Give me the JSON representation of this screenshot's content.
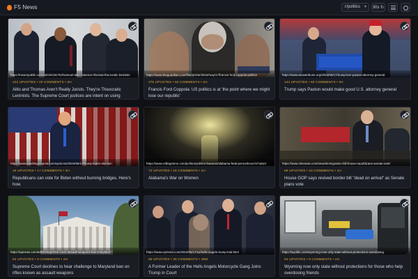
{
  "app": {
    "title": "F5 News"
  },
  "toolbar": {
    "subreddit": "r/politics",
    "refresh_label": "30s",
    "icons": [
      "chevron-down-icon",
      "refresh-icon",
      "grid-icon",
      "gear-icon"
    ]
  },
  "colors": {
    "accent": "#e2a93b",
    "background": "#0f1115",
    "card": "#1a1d24",
    "logo": "#f47b20"
  },
  "cards": [
    {
      "url": "https://newrepublic.com/article/181752/samuel-alito-clarence-thomas-theocratic-leninists",
      "meta": "423 UPVOTES • 20 COMMENTS • 2H",
      "title": "Alito and Thomas Aren't Really Jurists. They're Theocratic Leninists. The Supreme Court justices are intent on using maxim..."
    },
    {
      "url": "https://www.theguardian.com/film/article/2024/may/17/francis-ford-coppola-politics",
      "meta": "275 UPVOTES • 50 COMMENTS • 2H",
      "title": "Francis Ford Coppola: US politics is at 'the point where we might lose our republic'"
    },
    {
      "url": "https://www.texastribune.org/2024/05/17/trump-ken-paxton-attorney-general",
      "meta": "144 UPVOTES • 60 COMMENTS • 2H",
      "title": "Trump says Paxton would make good U.S. attorney general"
    },
    {
      "url": "https://www.washingtonpost.com/opinions/2024/05/17/trump-biden-election",
      "meta": "16 UPVOTES • 17 COMMENTS • 2H",
      "title": "Republicans can vote for Biden without burning bridges. Here's how."
    },
    {
      "url": "https://www.rollingstone.com/politics/politics-features/alabama-fetal-personhood-ivf-abort",
      "meta": "72 UPVOTES • 15 COMMENTS • 2H",
      "title": "Alabama's War on Women"
    },
    {
      "url": "https://www.cbsnews.com/news/immigration-bill-house-republicans-senate-vote/",
      "meta": "86 UPVOTES • 23 COMMENTS • 1H",
      "title": "House GOP says revived border bill \"dead on arrival\" as Senate plans vote"
    },
    {
      "url": "https://apnews.com/article/supreme-court-assault-weapons-ban-maryland",
      "meta": "54 UPVOTES • 8 COMMENTS • 2H",
      "title": "Supreme Court declines to hear challenge to Maryland ban on rifles known as assault weapons"
    },
    {
      "url": "https://www.nytimes.com/2024/05/17/us/hells-angels-trump-trial.html",
      "meta": "55 UPVOTES • 28 COMMENTS • 48M",
      "title": "A Former Leader of the Hells Angels Motorcycle Gang Joins Trump in Court"
    },
    {
      "url": "https://wyofile.com/wyoming-now-only-state-without-protections-overdosing",
      "meta": "54 UPVOTES • 9 COMMENTS • 2H",
      "title": "Wyoming now only state without protections for those who help overdosing friends"
    }
  ]
}
